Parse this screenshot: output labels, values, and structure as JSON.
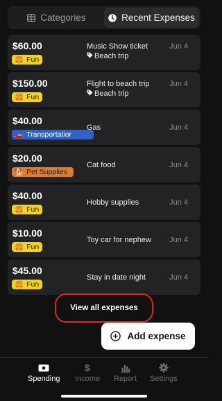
{
  "segmented": {
    "categories_label": "Categories",
    "recent_label": "Recent Expenses"
  },
  "expenses": [
    {
      "amount": "$60.00",
      "tag": "Fun",
      "tag_emoji": "🍔",
      "description": "Music Show ticket",
      "trip": "Beach trip",
      "date": "Jun 4"
    },
    {
      "amount": "$150.00",
      "tag": "Fun",
      "tag_emoji": "🍔",
      "description": "Flight to beach trip",
      "trip": "Beach trip",
      "date": "Jun 4"
    },
    {
      "amount": "$40.00",
      "tag": "Transportatior",
      "tag_emoji": "🚗",
      "description": "Gas",
      "date": "Jun 4"
    },
    {
      "amount": "$20.00",
      "tag": "Pet Supplies",
      "tag_emoji": "🐕",
      "description": "Cat food",
      "date": "Jun 4"
    },
    {
      "amount": "$40.00",
      "tag": "Fun",
      "tag_emoji": "🍔",
      "description": "Hobby supplies",
      "date": "Jun 4"
    },
    {
      "amount": "$10.00",
      "tag": "Fun",
      "tag_emoji": "🍔",
      "description": "Toy car for nephew",
      "date": "Jun 4"
    },
    {
      "amount": "$45.00",
      "tag": "Fun",
      "tag_emoji": "🍔",
      "description": "Stay in date night",
      "date": "Jun 4"
    }
  ],
  "actions": {
    "view_all": "View all expenses",
    "add_expense": "Add expense"
  },
  "tabbar": {
    "spending": "Spending",
    "income": "Income",
    "report": "Report",
    "settings": "Settings",
    "income_glyph": "$"
  },
  "colors": {
    "fun_tag": "#f2d21d",
    "transportation_tag": "#2f62c8",
    "pet_tag": "#e07b2a",
    "highlight_ring": "#e0251d"
  }
}
